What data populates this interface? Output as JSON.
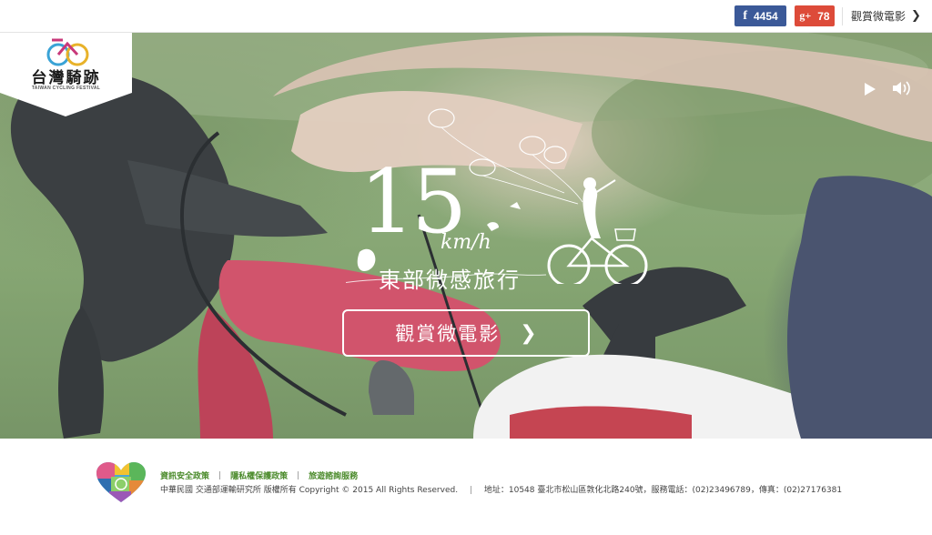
{
  "header": {
    "facebook": {
      "icon": "facebook-icon",
      "glyph": "f",
      "count": "4454",
      "color": "#3b5998"
    },
    "googleplus": {
      "icon": "googleplus-icon",
      "glyph": "g+",
      "count": "78",
      "color": "#dd4b39"
    },
    "watch_film_label": "觀賞微電影",
    "watch_film_icon": "chevron-right-icon"
  },
  "logo": {
    "title": "台灣騎跡",
    "subtitle": "TAIWAN CYCLING FESTIVAL"
  },
  "player": {
    "play_icon": "play-icon",
    "volume_icon": "volume-icon"
  },
  "hero": {
    "speed_number": "15",
    "speed_unit": "km/h",
    "tagline": "東部微感旅行",
    "cta_label": "觀賞微電影",
    "cta_icon": "chevron-right-icon"
  },
  "footer": {
    "links": [
      "資訊安全政策",
      "隱私權保護政策",
      "旅遊諮詢服務"
    ],
    "separator": "|",
    "copyright": "中華民國 交通部運輸研究所 版權所有 Copyright © 2015 All Rights Reserved.",
    "address": "地址：10548 臺北市松山區敦化北路240號，服務電話：(02)23496789，傳真：(02)27176381"
  },
  "colors": {
    "facebook": "#3b5998",
    "googleplus": "#dd4b39",
    "footer_link": "#4a8a2a",
    "footer_text": "#444444"
  }
}
